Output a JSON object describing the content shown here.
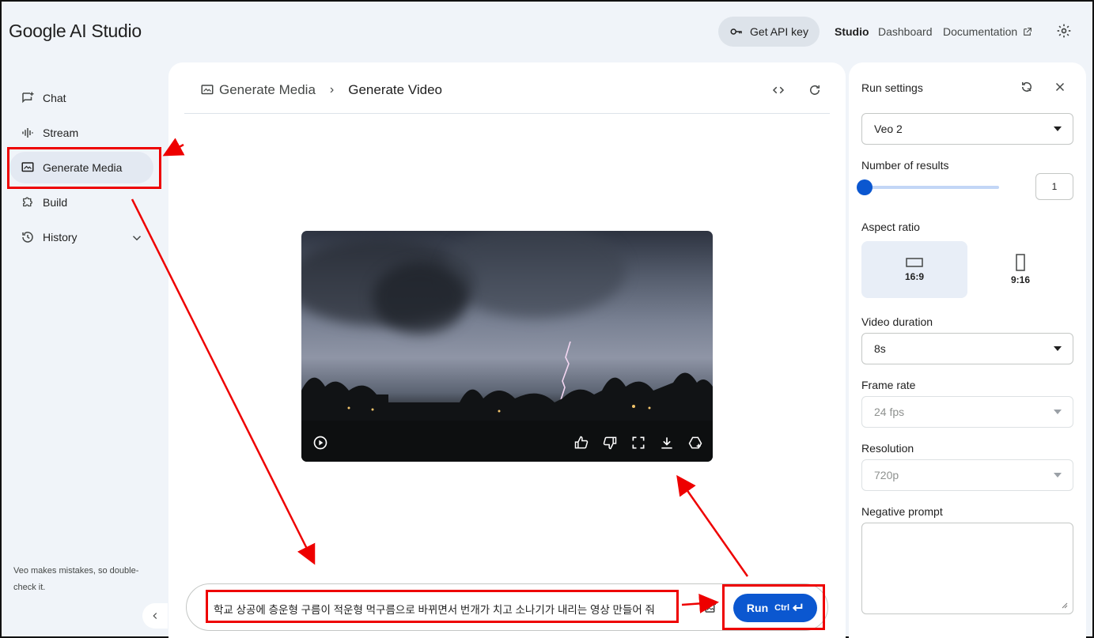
{
  "header": {
    "logo": "Google AI Studio",
    "api_key_button": "Get API key",
    "nav": {
      "studio": "Studio",
      "dashboard": "Dashboard",
      "documentation": "Documentation"
    }
  },
  "sidebar": {
    "items": [
      {
        "label": "Chat",
        "icon": "chat-icon"
      },
      {
        "label": "Stream",
        "icon": "stream-icon"
      },
      {
        "label": "Generate Media",
        "icon": "media-icon"
      },
      {
        "label": "Build",
        "icon": "build-icon"
      },
      {
        "label": "History",
        "icon": "history-icon"
      }
    ],
    "note": "Veo makes mistakes, so double-check it."
  },
  "main": {
    "breadcrumb": {
      "parent": "Generate Media",
      "current": "Generate Video"
    },
    "prompt": "학교 상공에 층운형 구름이 적운형 먹구름으로 바뀌면서 번개가 치고 소나기가 내리는 영상 만들어 줘",
    "run_label": "Run",
    "run_shortcut": "Ctrl"
  },
  "run_settings": {
    "title": "Run settings",
    "model": "Veo 2",
    "number_of_results_label": "Number of results",
    "number_of_results": "1",
    "aspect_ratio_label": "Aspect ratio",
    "aspect_ratios": [
      "16:9",
      "9:16"
    ],
    "video_duration_label": "Video duration",
    "video_duration": "8s",
    "frame_rate_label": "Frame rate",
    "frame_rate": "24 fps",
    "resolution_label": "Resolution",
    "resolution": "720p",
    "negative_prompt_label": "Negative prompt"
  },
  "colors": {
    "accent": "#0b57d0",
    "annotation": "#ee0000",
    "background": "#f0f4f9"
  }
}
